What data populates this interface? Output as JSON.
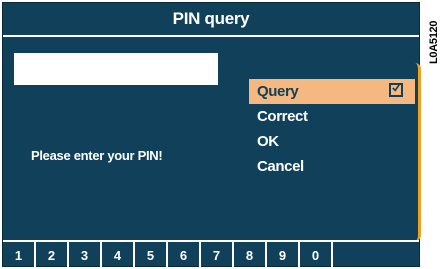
{
  "title": "PIN query",
  "pin_field": {
    "value": ""
  },
  "prompt": "Please enter your PIN!",
  "menu": {
    "items": [
      {
        "label": "Query",
        "selected": true,
        "checked": true
      },
      {
        "label": "Correct"
      },
      {
        "label": "OK"
      },
      {
        "label": "Cancel"
      }
    ]
  },
  "softkeys": [
    "1",
    "2",
    "3",
    "4",
    "5",
    "6",
    "7",
    "8",
    "9",
    "0"
  ],
  "side_label": "L0A5120",
  "colors": {
    "screen_bg": "#10405a",
    "selection_bg": "#f4b880",
    "scroll_bracket": "#f0a020",
    "text": "#ffffff"
  },
  "icons": {
    "checkbox": "checked-checkbox-icon"
  }
}
